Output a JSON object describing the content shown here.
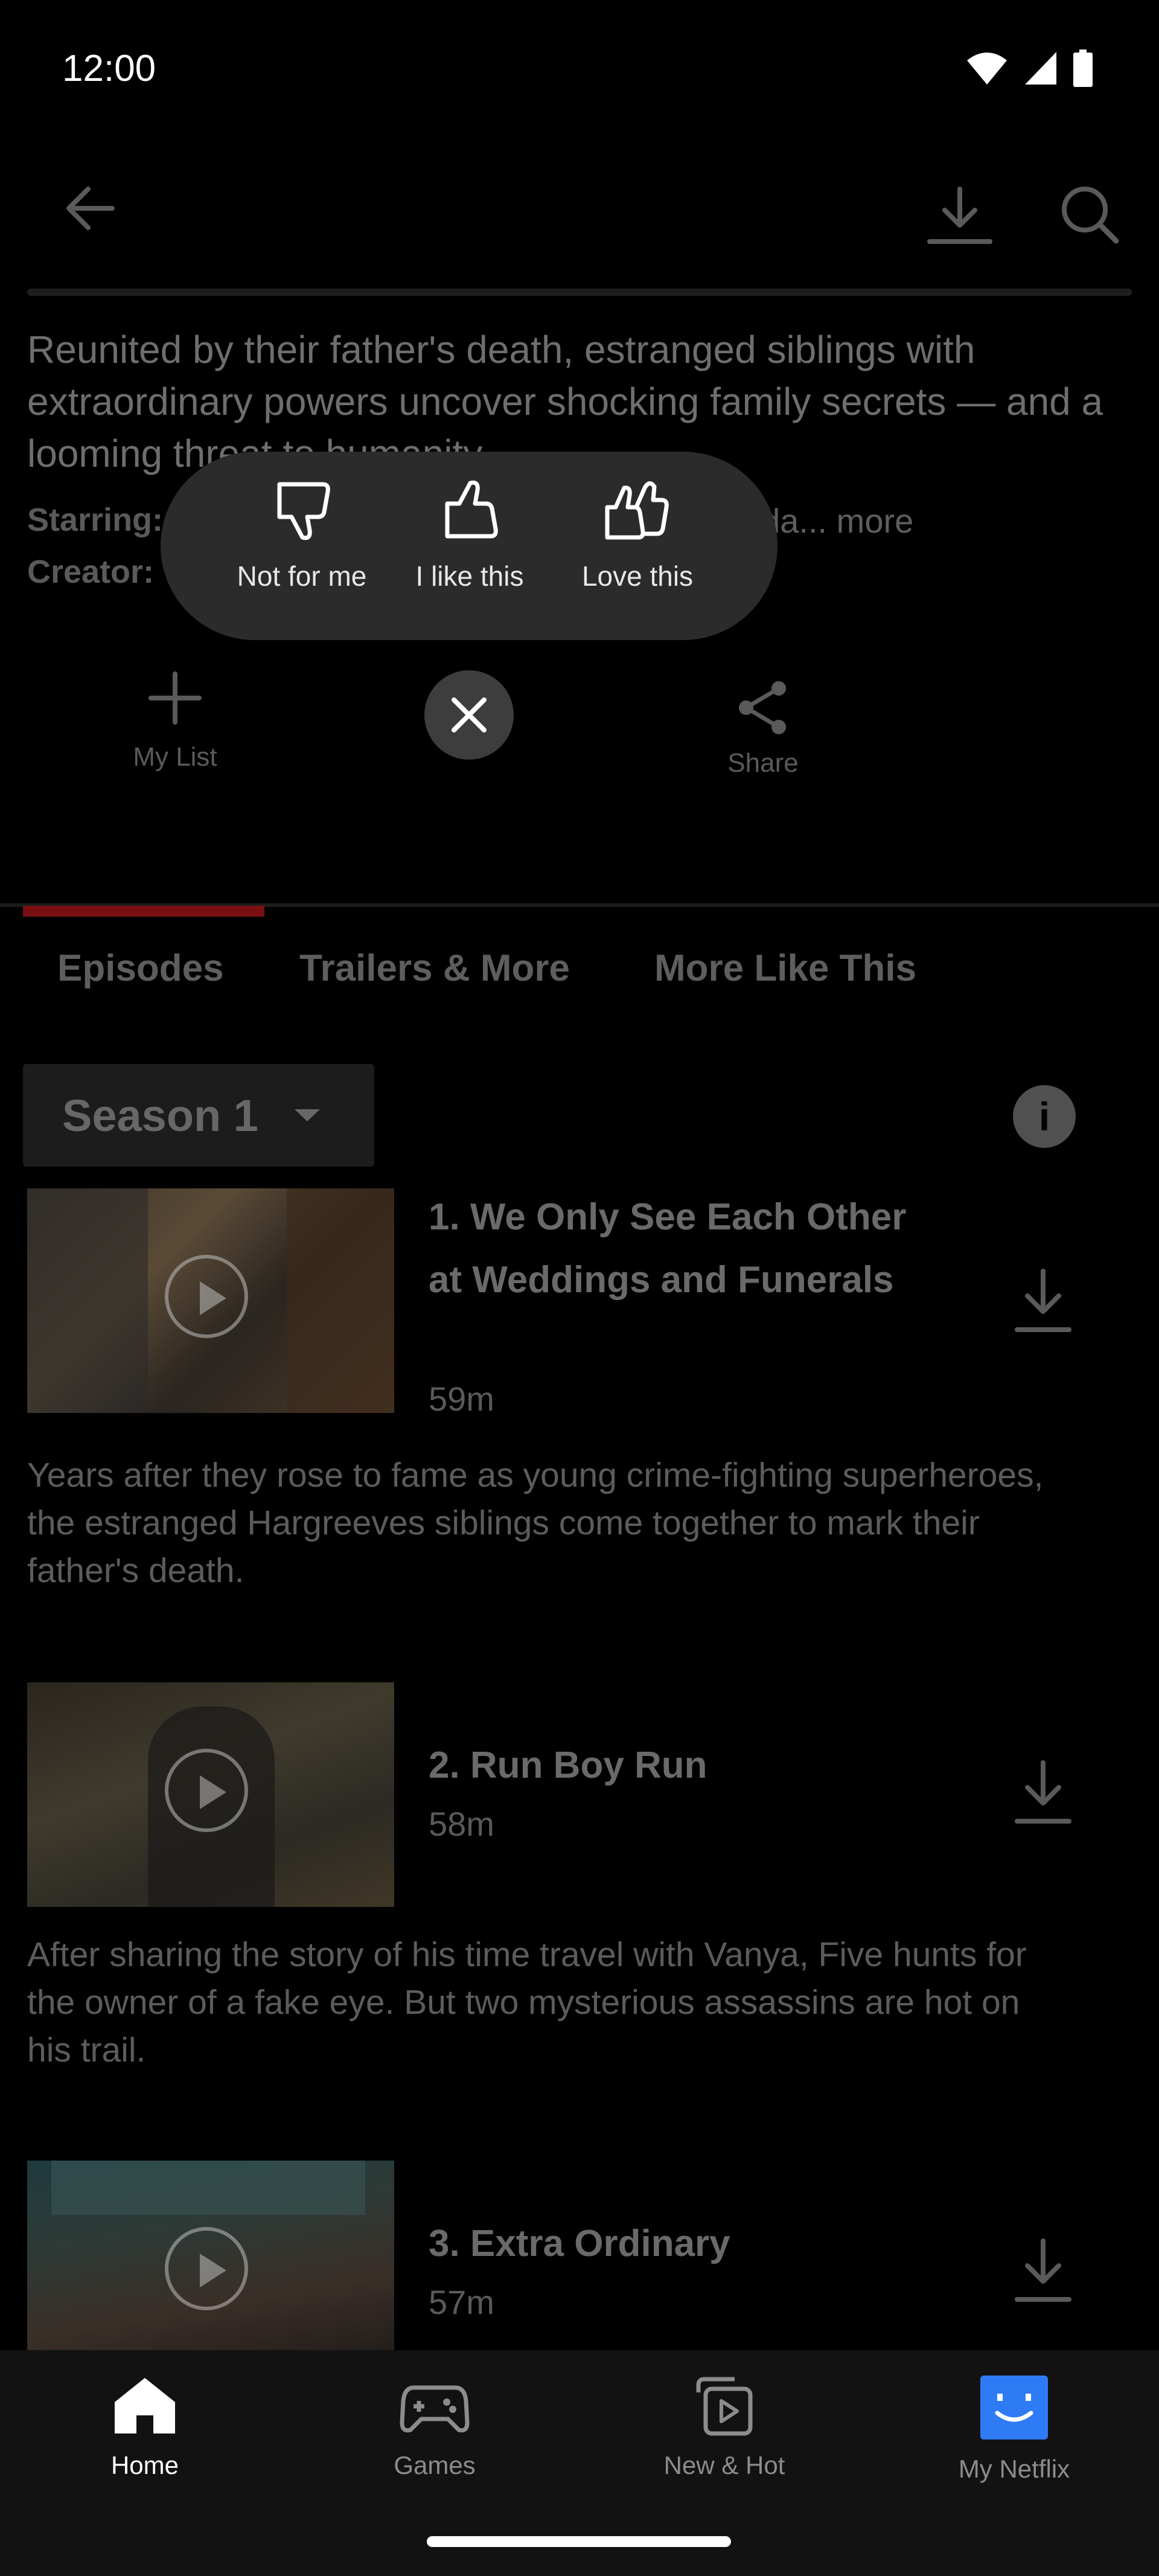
{
  "status_bar": {
    "time": "12:00"
  },
  "synopsis": "Reunited by their father's death, estranged siblings with extraordinary powers uncover shocking family secrets — and a looming threat to humanity.",
  "credits": {
    "starring_label": "Starring:",
    "starring_partial": "eda...",
    "more": "more",
    "creator_label": "Creator:"
  },
  "actions": {
    "my_list": "My List",
    "share": "Share"
  },
  "rating": {
    "not_for_me": "Not for me",
    "like": "I like this",
    "love": "Love this"
  },
  "tabs": [
    "Episodes",
    "Trailers & More",
    "More Like This"
  ],
  "season": {
    "selected": "Season 1"
  },
  "episodes": [
    {
      "title": "1. We Only See Each Other at Weddings and Funerals",
      "duration": "59m",
      "description": "Years after they rose to fame as young crime-fighting superheroes, the estranged Hargreeves siblings come together to mark their father's death."
    },
    {
      "title": "2. Run Boy Run",
      "duration": "58m",
      "description": "After sharing the story of his time travel with Vanya, Five hunts for the owner of a fake eye. But two mysterious assassins are hot on his trail."
    },
    {
      "title": "3. Extra Ordinary",
      "duration": "57m",
      "description": ""
    }
  ],
  "bottom_nav": [
    {
      "label": "Home",
      "icon": "home-icon",
      "active": true
    },
    {
      "label": "Games",
      "icon": "gamepad-icon",
      "active": false
    },
    {
      "label": "New & Hot",
      "icon": "new-hot-icon",
      "active": false
    },
    {
      "label": "My Netflix",
      "icon": "profile-avatar",
      "active": false
    }
  ],
  "colors": {
    "accent": "#E50914",
    "avatar": "#2F7BF5"
  }
}
